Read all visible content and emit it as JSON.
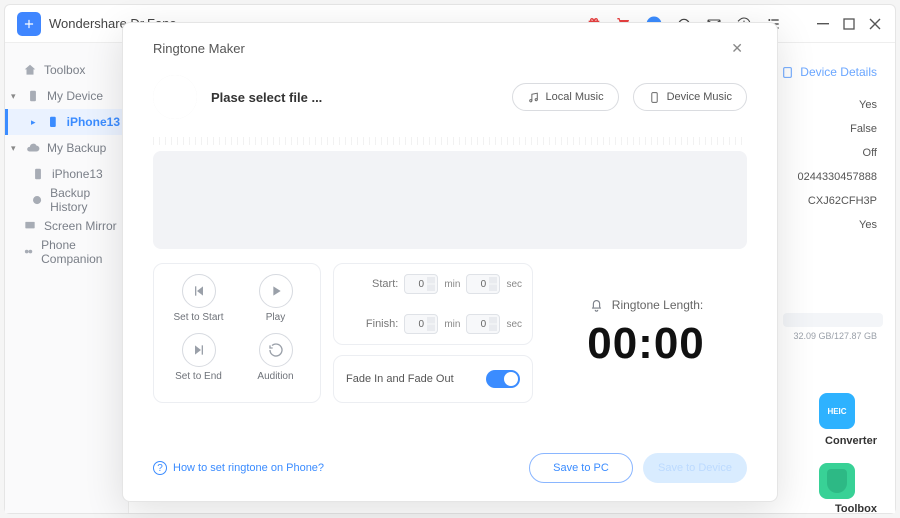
{
  "app": {
    "title": "Wondershare Dr.Fone"
  },
  "sidebar": {
    "items": [
      {
        "label": "Toolbox"
      },
      {
        "label": "My Device"
      },
      {
        "label": "iPhone13"
      },
      {
        "label": "My Backup"
      },
      {
        "label": "iPhone13"
      },
      {
        "label": "Backup History"
      },
      {
        "label": "Screen Mirror"
      },
      {
        "label": "Phone Companion"
      }
    ]
  },
  "details": {
    "link": "Device Details",
    "values": [
      "Yes",
      "False",
      "Off",
      "0244330457888",
      "CXJ62CFH3P",
      "Yes"
    ],
    "storage": "32.09 GB/127.87 GB",
    "heic": "HEIC",
    "heic_label": "Converter",
    "toolbox_label": "Toolbox"
  },
  "modal": {
    "title": "Ringtone Maker",
    "select_file": "Plase select file ...",
    "local_music": "Local Music",
    "device_music": "Device Music",
    "set_to_start": "Set to Start",
    "play": "Play",
    "set_to_end": "Set to End",
    "audition": "Audition",
    "start_label": "Start:",
    "finish_label": "Finish:",
    "start_min": "0",
    "start_sec": "0",
    "finish_min": "0",
    "finish_sec": "0",
    "unit_min": "min",
    "unit_sec": "sec",
    "fade": "Fade In and Fade Out",
    "length_label": "Ringtone Length:",
    "big_time": "00:00",
    "help": "How to set ringtone on Phone?",
    "save_pc": "Save to PC",
    "save_device": "Save to Device"
  }
}
